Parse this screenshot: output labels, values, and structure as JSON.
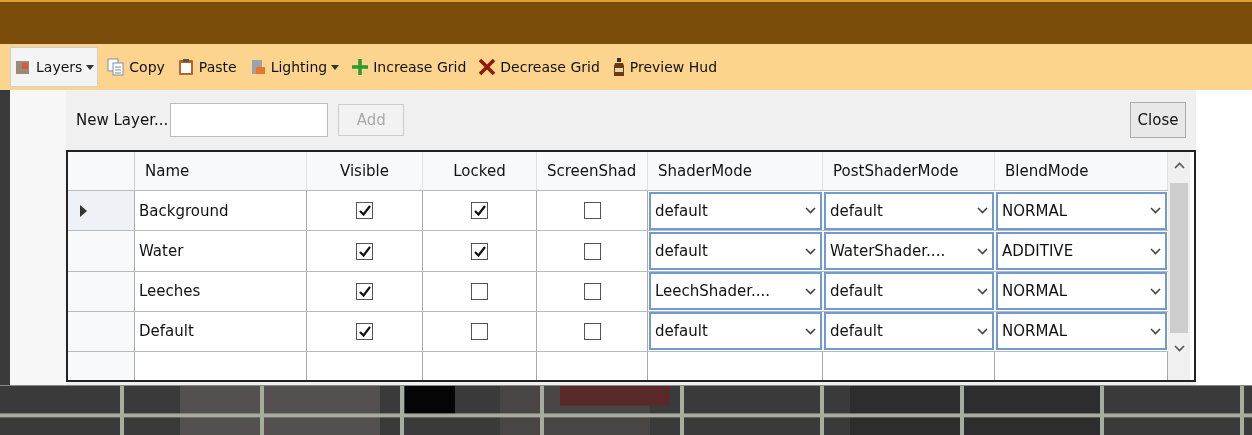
{
  "toolbar": [
    {
      "label": "Layers",
      "kind": "dropdown",
      "selected": true
    },
    {
      "label": "Copy",
      "kind": "button",
      "selected": false
    },
    {
      "label": "Paste",
      "kind": "button",
      "selected": false
    },
    {
      "label": "Lighting",
      "kind": "dropdown",
      "selected": false
    },
    {
      "label": "Increase Grid",
      "kind": "button",
      "selected": false
    },
    {
      "label": "Decrease Grid",
      "kind": "button",
      "selected": false
    },
    {
      "label": "Preview Hud",
      "kind": "button",
      "selected": false
    }
  ],
  "new_layer": {
    "label": "New Layer...",
    "add": {
      "label": "Add",
      "disabled": true
    },
    "close": "Close"
  },
  "table": {
    "columns": [
      "Name",
      "Visible",
      "Locked",
      "ScreenShad",
      "ShaderMode",
      "PostShaderMode",
      "BlendMode"
    ],
    "rows": [
      {
        "current": true,
        "name": "Background",
        "visible": true,
        "locked": true,
        "screen_shader": false,
        "shader_mode": "default",
        "post_shader_mode": "default",
        "blend_mode": "NORMAL"
      },
      {
        "current": false,
        "name": "Water",
        "visible": true,
        "locked": true,
        "screen_shader": false,
        "shader_mode": "default",
        "post_shader_mode": "WaterShader....",
        "blend_mode": "ADDITIVE"
      },
      {
        "current": false,
        "name": "Leeches",
        "visible": true,
        "locked": false,
        "screen_shader": false,
        "shader_mode": "LeechShader....",
        "post_shader_mode": "default",
        "blend_mode": "NORMAL"
      },
      {
        "current": false,
        "name": "Default",
        "visible": true,
        "locked": false,
        "screen_shader": false,
        "shader_mode": "default",
        "post_shader_mode": "default",
        "blend_mode": "NORMAL"
      }
    ]
  }
}
